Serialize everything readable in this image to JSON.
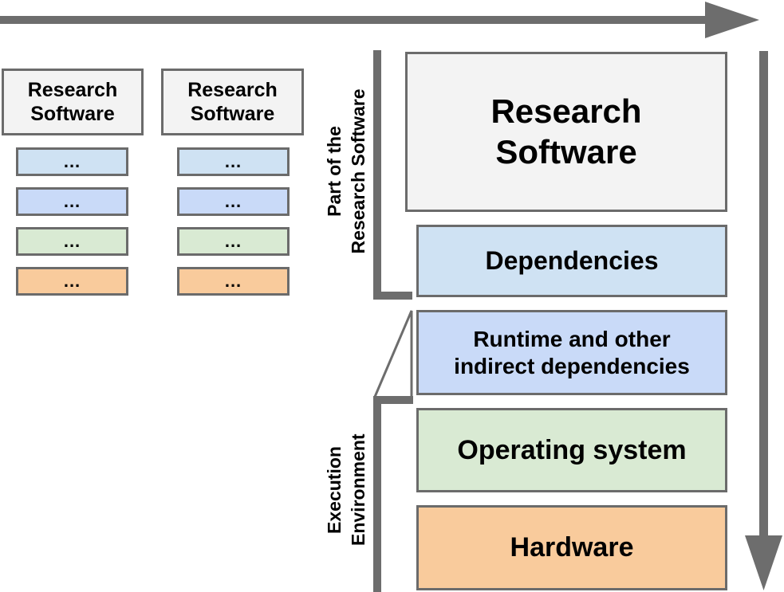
{
  "colors": {
    "software": "#f3f3f3",
    "dependencies": "#cfe2f3",
    "runtime": "#c9daf8",
    "os": "#d9ead3",
    "hardware": "#f9cb9c",
    "border": "#6b6b6b",
    "arrow": "#6d6d6d"
  },
  "columns": [
    {
      "title": "Research Software",
      "layers": [
        "...",
        "...",
        "...",
        "..."
      ]
    },
    {
      "title": "Research Software",
      "layers": [
        "...",
        "...",
        "...",
        "..."
      ]
    }
  ],
  "stack": {
    "research_software": "Research Software",
    "dependencies": "Dependencies",
    "runtime": "Runtime and other indirect dependencies",
    "os": "Operating system",
    "hardware": "Hardware"
  },
  "brackets": {
    "part_of_software": "Part of the Research Software",
    "execution_environment": "Execution Environment"
  }
}
